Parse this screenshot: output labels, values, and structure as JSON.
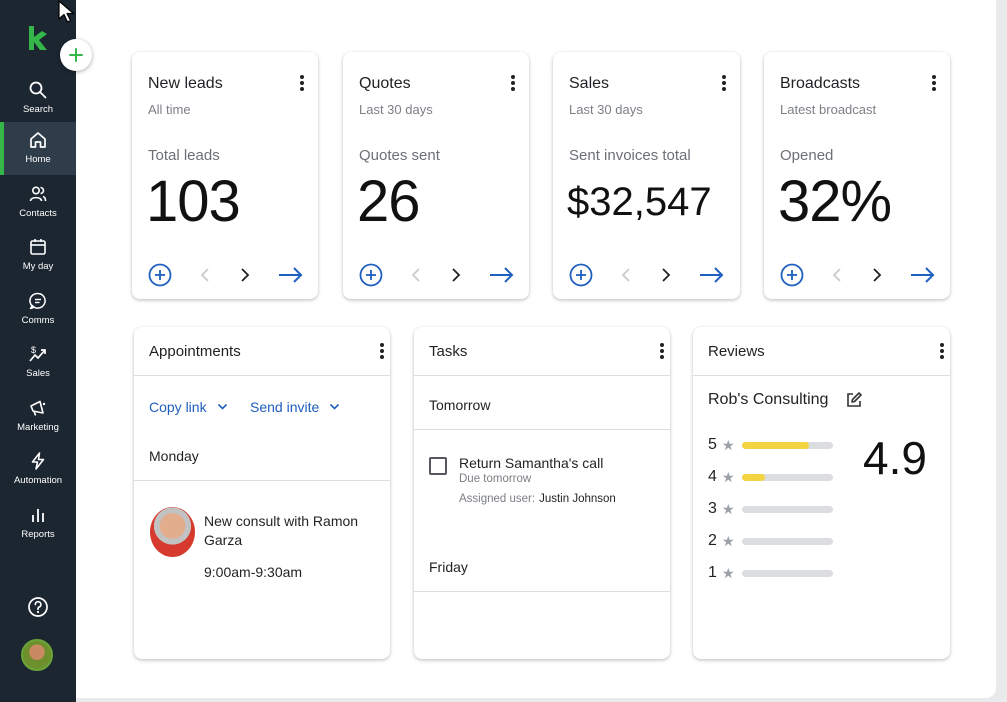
{
  "sidebar": {
    "items": [
      {
        "label": "Search",
        "icon": "search-icon"
      },
      {
        "label": "Home",
        "icon": "home-icon"
      },
      {
        "label": "Contacts",
        "icon": "contacts-icon"
      },
      {
        "label": "My day",
        "icon": "calendar-icon"
      },
      {
        "label": "Comms",
        "icon": "chat-icon"
      },
      {
        "label": "Sales",
        "icon": "sales-icon"
      },
      {
        "label": "Marketing",
        "icon": "megaphone-icon"
      },
      {
        "label": "Automation",
        "icon": "lightning-icon"
      },
      {
        "label": "Reports",
        "icon": "bar-chart-icon"
      }
    ],
    "active": "Home",
    "accent": "#35b649"
  },
  "stats": [
    {
      "title": "New leads",
      "subtitle": "All time",
      "label": "Total leads",
      "value": "103"
    },
    {
      "title": "Quotes",
      "subtitle": "Last 30 days",
      "label": "Quotes sent",
      "value": "26"
    },
    {
      "title": "Sales",
      "subtitle": "Last 30 days",
      "label": "Sent invoices total",
      "value": "$32,547"
    },
    {
      "title": "Broadcasts",
      "subtitle": "Latest broadcast",
      "label": "Opened",
      "value": "32%"
    }
  ],
  "appointments": {
    "title": "Appointments",
    "copy_link": "Copy link",
    "send_invite": "Send invite",
    "day": "Monday",
    "event_title": "New consult with Ramon Garza",
    "event_time": "9:00am-9:30am"
  },
  "tasks": {
    "title": "Tasks",
    "section1": "Tomorrow",
    "task_title": "Return Samantha's call",
    "task_due": "Due tomorrow",
    "assigned_label": "Assigned user:",
    "assigned_name": "Justin Johnson",
    "section2": "Friday"
  },
  "reviews": {
    "title": "Reviews",
    "business": "Rob's Consulting",
    "average": "4.9",
    "ratings": [
      {
        "stars": "5",
        "fraction": 0.74
      },
      {
        "stars": "4",
        "fraction": 0.25
      },
      {
        "stars": "3",
        "fraction": 0
      },
      {
        "stars": "2",
        "fraction": 0
      },
      {
        "stars": "1",
        "fraction": 0
      }
    ],
    "bar_color": "#f3d33f"
  },
  "colors": {
    "link_blue": "#1f5fbf",
    "sidebar_bg": "#1b2631",
    "brand_green": "#35b649"
  }
}
